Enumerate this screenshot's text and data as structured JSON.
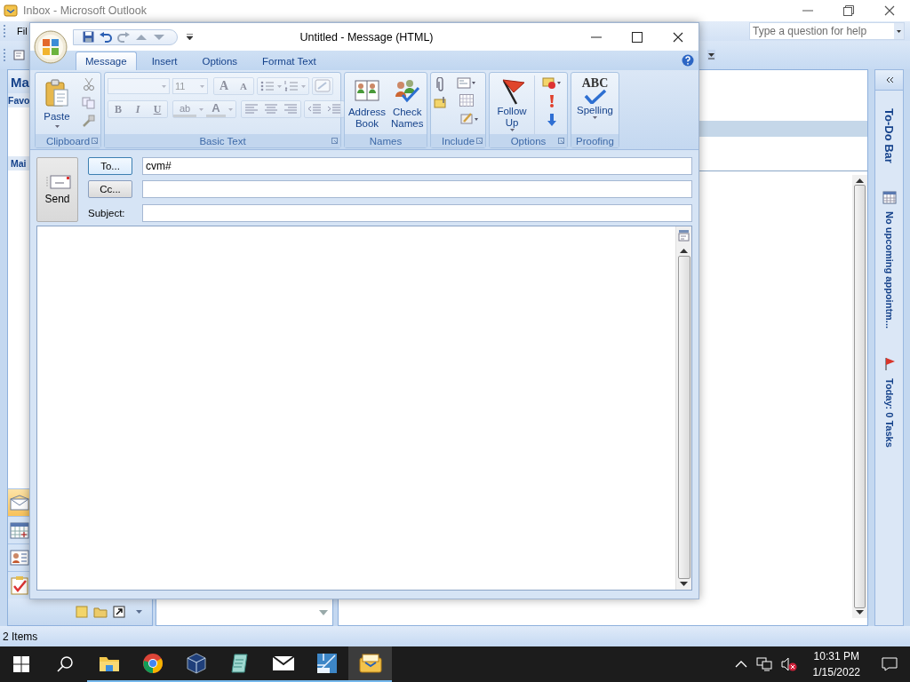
{
  "outlook": {
    "title": "Inbox - Microsoft Outlook",
    "menu": [
      "Fil"
    ],
    "help_box": {
      "placeholder": "Type a question for help"
    },
    "nav_pane": {
      "header": "Ma",
      "favorites": "Favo",
      "mail": "Mai",
      "buttons": [
        {
          "kind": "mail",
          "selected": true
        },
        {
          "kind": "calendar",
          "selected": false
        },
        {
          "kind": "contacts",
          "selected": false
        },
        {
          "kind": "tasks",
          "selected": false
        }
      ]
    },
    "todo_bar": {
      "title": "To-Do Bar",
      "appointments": "No upcoming appointm...",
      "tasks": "Today: 0 Tasks"
    },
    "status_bar": "2 Items"
  },
  "compose": {
    "title": "Untitled - Message (HTML)",
    "tabs": [
      {
        "label": "Message",
        "selected": true
      },
      {
        "label": "Insert",
        "selected": false
      },
      {
        "label": "Options",
        "selected": false
      },
      {
        "label": "Format Text",
        "selected": false
      }
    ],
    "groups": [
      {
        "kind": "clipboard",
        "label": "Clipboard",
        "paste": "Paste"
      },
      {
        "kind": "basic_text",
        "label": "Basic Text",
        "disabled": true,
        "font_size": "11",
        "grow": "A",
        "shrink": "A",
        "bold": "B",
        "italic": "I",
        "underline": "U",
        "highlight": "ab",
        "font_color": "A"
      },
      {
        "kind": "names",
        "label": "Names",
        "buttons": [
          "Address Book",
          "Check Names"
        ]
      },
      {
        "kind": "include",
        "label": "Include"
      },
      {
        "kind": "options",
        "label": "Options",
        "follow_up": "Follow Up"
      },
      {
        "kind": "proofing",
        "label": "Proofing",
        "badge": "ABC",
        "spelling": "Spelling"
      }
    ],
    "send": "Send",
    "to": {
      "button": "To...",
      "value": "cvm#"
    },
    "cc": {
      "button": "Cc..."
    },
    "subject": {
      "label": "Subject:"
    }
  },
  "taskbar": {
    "apps": [
      {
        "kind": "explorer",
        "selected": false
      },
      {
        "kind": "chrome",
        "selected": false
      },
      {
        "kind": "virtualbox",
        "selected": false
      },
      {
        "kind": "notepad",
        "selected": false
      },
      {
        "kind": "mail",
        "selected": false
      },
      {
        "kind": "vista",
        "selected": false
      },
      {
        "kind": "outlook",
        "selected": true
      }
    ],
    "time": "10:31 PM",
    "date": "1/15/2022"
  }
}
